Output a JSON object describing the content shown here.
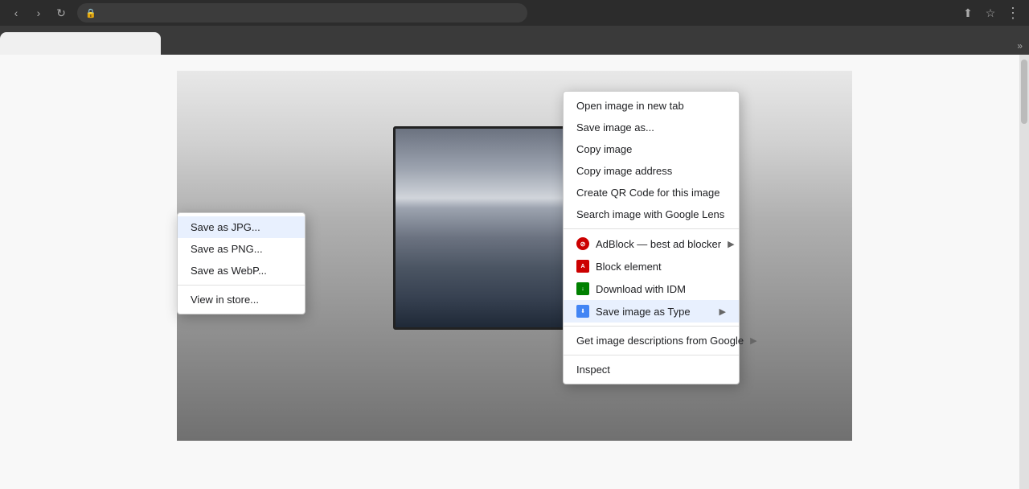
{
  "browser": {
    "nav": {
      "back_label": "‹",
      "forward_label": "›",
      "reload_label": "↻"
    },
    "address_bar": {
      "lock_icon": "🔒",
      "url": ""
    },
    "actions": {
      "share_icon": "⬆",
      "bookmark_icon": "☆",
      "more_icon": "⋮",
      "extend_icon": "»"
    },
    "tab": {
      "label": ""
    }
  },
  "context_menu": {
    "items": [
      {
        "id": "open-new-tab",
        "label": "Open image in new tab",
        "icon": null,
        "has_arrow": false
      },
      {
        "id": "save-image-as",
        "label": "Save image as...",
        "icon": null,
        "has_arrow": false
      },
      {
        "id": "copy-image",
        "label": "Copy image",
        "icon": null,
        "has_arrow": false
      },
      {
        "id": "copy-image-address",
        "label": "Copy image address",
        "icon": null,
        "has_arrow": false
      },
      {
        "id": "create-qr-code",
        "label": "Create QR Code for this image",
        "icon": null,
        "has_arrow": false
      },
      {
        "id": "search-google-lens",
        "label": "Search image with Google Lens",
        "icon": null,
        "has_arrow": false
      },
      {
        "id": "adblock",
        "label": "AdBlock — best ad blocker",
        "icon": "adblock",
        "has_arrow": true
      },
      {
        "id": "block-element",
        "label": "Block element",
        "icon": "abp",
        "has_arrow": false
      },
      {
        "id": "download-idm",
        "label": "Download with IDM",
        "icon": "idm",
        "has_arrow": false
      },
      {
        "id": "save-image-type",
        "label": "Save image as Type",
        "icon": "savetype",
        "has_arrow": true,
        "highlighted": true
      },
      {
        "id": "get-image-desc",
        "label": "Get image descriptions from Google",
        "icon": null,
        "has_arrow": true
      },
      {
        "id": "inspect",
        "label": "Inspect",
        "icon": null,
        "has_arrow": false
      }
    ],
    "submenu": {
      "items": [
        {
          "id": "save-jpg",
          "label": "Save as JPG...",
          "highlighted": true
        },
        {
          "id": "save-png",
          "label": "Save as PNG..."
        },
        {
          "id": "save-webp",
          "label": "Save as WebP..."
        },
        {
          "id": "view-store",
          "label": "View in store..."
        }
      ]
    }
  }
}
